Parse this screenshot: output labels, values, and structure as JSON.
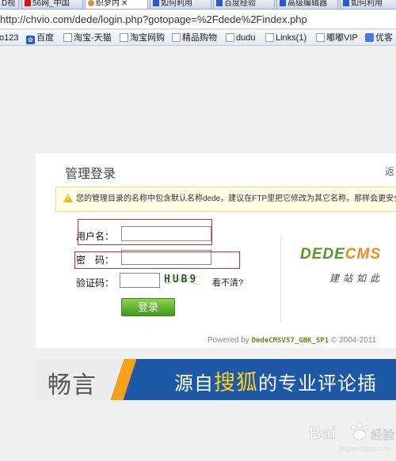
{
  "browser": {
    "tabs": [
      {
        "label": "D视",
        "active": false
      },
      {
        "label": "56网_中国",
        "active": false
      },
      {
        "label": "织梦内",
        "active": true
      },
      {
        "label": "如何利用",
        "active": false
      },
      {
        "label": "百度经验",
        "active": false
      },
      {
        "label": "高级编辑器",
        "active": false
      },
      {
        "label": "如何利用",
        "active": false
      }
    ],
    "url": "http://chvio.com/dede/login.php?gotopage=%2Fdede%2Findex.php",
    "bookmarks": [
      {
        "label": "o123"
      },
      {
        "label": "百度",
        "icon": "paw-icon"
      },
      {
        "label": "淘宝-天猫",
        "icon": "page-icon"
      },
      {
        "label": "淘宝网购",
        "icon": "page-icon"
      },
      {
        "label": "精品购物",
        "icon": "folder-icon"
      },
      {
        "label": "dudu",
        "icon": "folder-icon"
      },
      {
        "label": "Links(1)",
        "icon": "folder-icon"
      },
      {
        "label": "嘟嘟VIP",
        "icon": "folder-icon"
      },
      {
        "label": "优客",
        "icon": "taobao-icon"
      }
    ]
  },
  "login": {
    "title": "管理登录",
    "corner_text": "返",
    "warning": "您的管理目录的名称中包含默认名称dede，建议在FTP里把它修改为其它名称，那样会更安全！",
    "username_label": "用户名：",
    "username_value": "",
    "password_label": "密　码：",
    "password_value": "",
    "captcha_label": "验证码：",
    "captcha_value": "",
    "captcha_image_text": "HUB9",
    "captcha_refresh": "看不清?",
    "submit": "登录",
    "logo_part1": "DEDE",
    "logo_part2": "CMS",
    "slogan": "建站如此",
    "powered_prefix": "Powered by ",
    "powered_version": "DedeCMSV57_GBK_SP1",
    "powered_suffix": " © 2004-2011"
  },
  "ad": {
    "brand": "畅言",
    "text_before": "源自",
    "text_highlight": "搜狐",
    "text_after": "的专业评论插"
  },
  "watermark": {
    "text": "Bai 经验",
    "domain": "jingyan.baidu.com"
  },
  "colors": {
    "highlight_box": "#d62a2a",
    "login_button": "#4fa824",
    "ad_blue": "#1d59a6",
    "ad_orange": "#f3a21a"
  }
}
